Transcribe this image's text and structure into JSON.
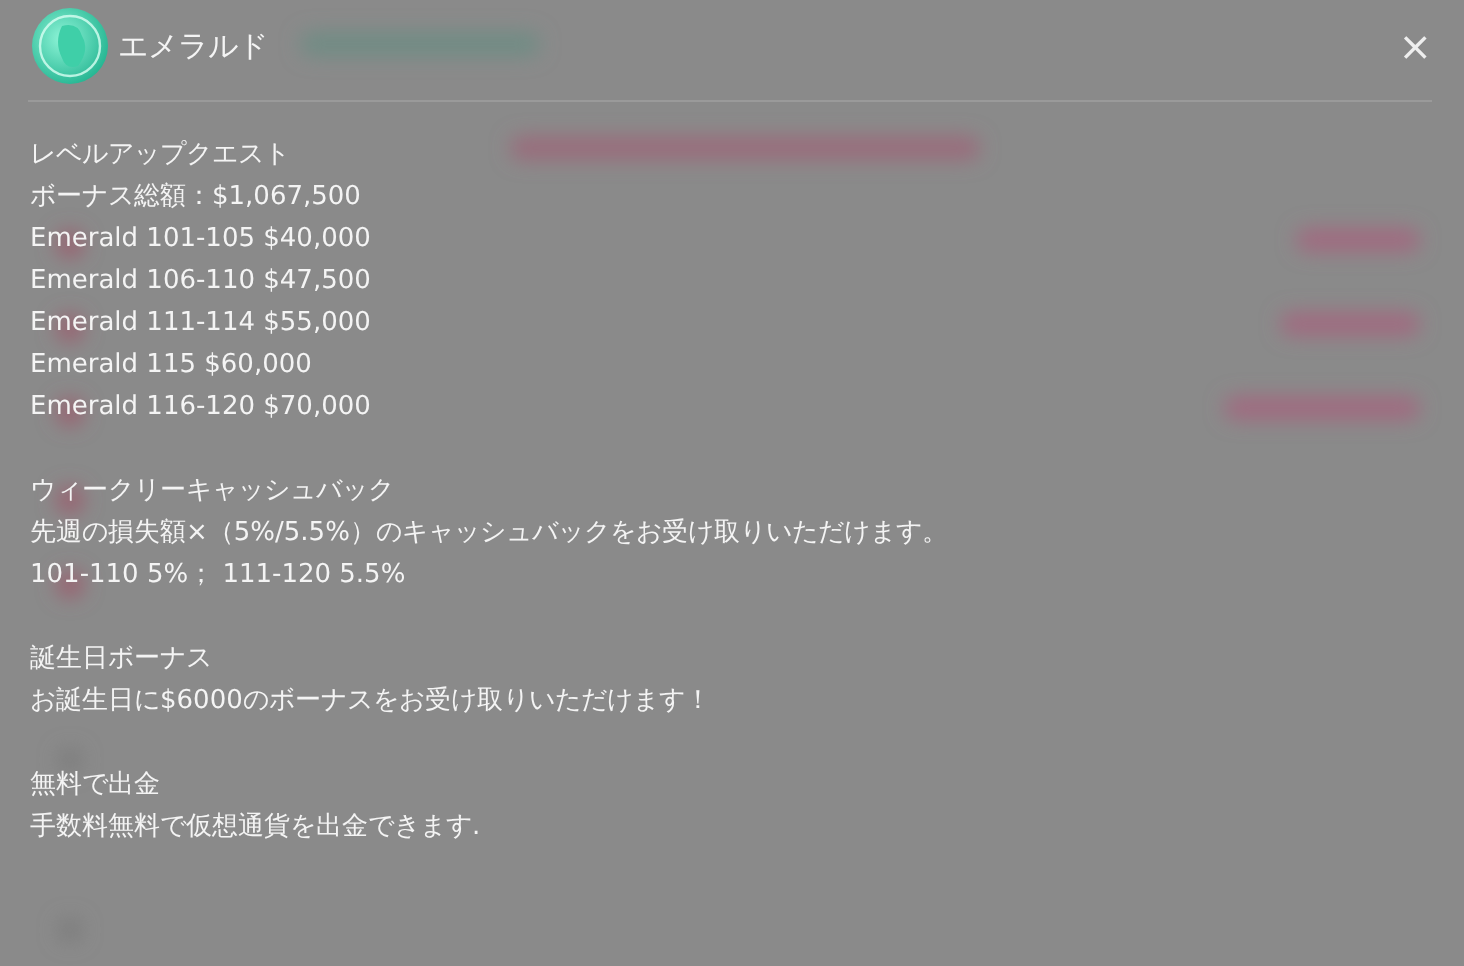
{
  "dialog": {
    "title": "エメラルド",
    "close": "×"
  },
  "sections": [
    {
      "heading": "レベルアップクエスト",
      "lines": [
        "ボーナス総額：$1,067,500",
        "Emerald 101-105 $40,000",
        "Emerald 106-110 $47,500",
        "Emerald 111-114 $55,000",
        "Emerald 115 $60,000",
        "Emerald 116-120 $70,000"
      ]
    },
    {
      "heading": "ウィークリーキャッシュバック",
      "lines": [
        "先週の損失額×（5%/5.5%）のキャッシュバックをお受け取りいただけます。",
        "101-110 5%； 111-120 5.5%"
      ]
    },
    {
      "heading": "誕生日ボーナス",
      "lines": [
        "お誕生日に$6000のボーナスをお受け取りいただけます！"
      ]
    },
    {
      "heading": "無料で出金",
      "lines": [
        "手数料無料で仮想通貨を出金できます."
      ]
    }
  ]
}
